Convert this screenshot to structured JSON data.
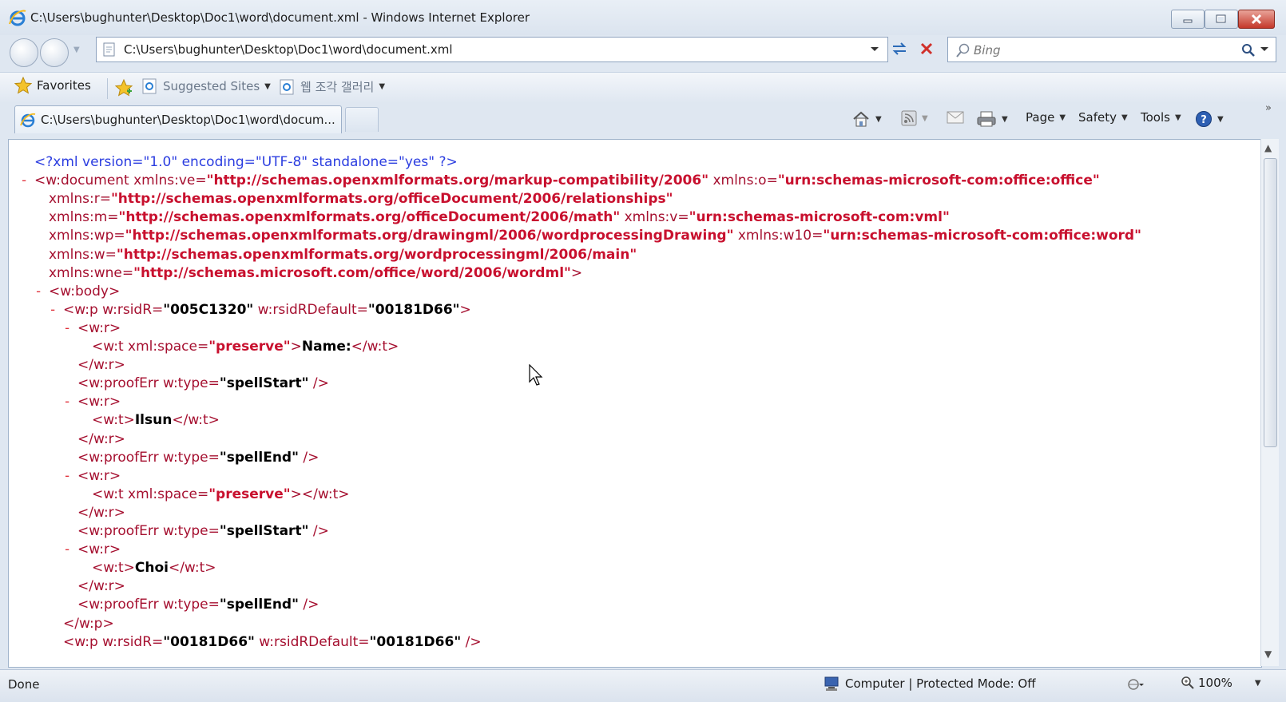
{
  "window": {
    "title": "C:\\Users\\bughunter\\Desktop\\Doc1\\word\\document.xml - Windows Internet Explorer"
  },
  "address_bar": {
    "url": "C:\\Users\\bughunter\\Desktop\\Doc1\\word\\document.xml"
  },
  "search": {
    "placeholder": "Bing"
  },
  "favorites_bar": {
    "favorites_label": "Favorites",
    "suggested_sites_label": "Suggested Sites",
    "web_slice_label": "웹 조각 갤러리"
  },
  "tab": {
    "label": "C:\\Users\\bughunter\\Desktop\\Doc1\\word\\docum..."
  },
  "command_bar": {
    "page_label": "Page",
    "safety_label": "Safety",
    "tools_label": "Tools"
  },
  "xml_lines": [
    {
      "minus": "",
      "parts": [
        [
          "b",
          "<?xml version=\"1.0\" encoding=\"UTF-8\" standalone=\"yes\" ?>"
        ]
      ]
    },
    {
      "minus": "-",
      "parts": [
        [
          "r",
          "<w:document "
        ],
        [
          "r",
          "xmlns:ve="
        ],
        [
          "rv",
          "\"http://schemas.openxmlformats.org/markup-compatibility/2006\""
        ],
        [
          "r",
          " xmlns:o="
        ],
        [
          "rv",
          "\"urn:schemas-microsoft-com:office:office\""
        ]
      ]
    },
    {
      "minus": "",
      "parts": [
        [
          "r",
          "xmlns:r="
        ],
        [
          "rv",
          "\"http://schemas.openxmlformats.org/officeDocument/2006/relationships\""
        ]
      ]
    },
    {
      "minus": "",
      "parts": [
        [
          "r",
          "xmlns:m="
        ],
        [
          "rv",
          "\"http://schemas.openxmlformats.org/officeDocument/2006/math\""
        ],
        [
          "r",
          " xmlns:v="
        ],
        [
          "rv",
          "\"urn:schemas-microsoft-com:vml\""
        ]
      ]
    },
    {
      "minus": "",
      "parts": [
        [
          "r",
          "xmlns:wp="
        ],
        [
          "rv",
          "\"http://schemas.openxmlformats.org/drawingml/2006/wordprocessingDrawing\""
        ],
        [
          "r",
          " xmlns:w10="
        ],
        [
          "rv",
          "\"urn:schemas-microsoft-com:office:word\""
        ]
      ]
    },
    {
      "minus": "",
      "parts": [
        [
          "r",
          "xmlns:w="
        ],
        [
          "rv",
          "\"http://schemas.openxmlformats.org/wordprocessingml/2006/main\""
        ]
      ]
    },
    {
      "minus": "",
      "parts": [
        [
          "r",
          "xmlns:wne="
        ],
        [
          "rv",
          "\"http://schemas.microsoft.com/office/word/2006/wordml\""
        ],
        [
          "r",
          ">"
        ]
      ]
    },
    {
      "minus": "-",
      "parts": [
        [
          "r",
          "<w:body>"
        ]
      ]
    },
    {
      "minus": "-",
      "parts": [
        [
          "r",
          "<w:p w:rsidR="
        ],
        [
          "t",
          "\"005C1320\""
        ],
        [
          "r",
          " w:rsidRDefault="
        ],
        [
          "t",
          "\"00181D66\""
        ],
        [
          "r",
          ">"
        ]
      ]
    },
    {
      "minus": "-",
      "parts": [
        [
          "r",
          "<w:r>"
        ]
      ]
    },
    {
      "minus": "",
      "parts": [
        [
          "r",
          "<w:t xml:space="
        ],
        [
          "rv",
          "\"preserve\""
        ],
        [
          "r",
          ">"
        ],
        [
          "t",
          "Name:"
        ],
        [
          "r",
          "</w:t>"
        ]
      ]
    },
    {
      "minus": "",
      "parts": [
        [
          "r",
          "</w:r>"
        ]
      ]
    },
    {
      "minus": "",
      "parts": [
        [
          "r",
          "<w:proofErr w:type="
        ],
        [
          "t",
          "\"spellStart\""
        ],
        [
          "r",
          " />"
        ]
      ]
    },
    {
      "minus": "-",
      "parts": [
        [
          "r",
          "<w:r>"
        ]
      ]
    },
    {
      "minus": "",
      "parts": [
        [
          "r",
          "<w:t>"
        ],
        [
          "t",
          "Ilsun"
        ],
        [
          "r",
          "</w:t>"
        ]
      ]
    },
    {
      "minus": "",
      "parts": [
        [
          "r",
          "</w:r>"
        ]
      ]
    },
    {
      "minus": "",
      "parts": [
        [
          "r",
          "<w:proofErr w:type="
        ],
        [
          "t",
          "\"spellEnd\""
        ],
        [
          "r",
          " />"
        ]
      ]
    },
    {
      "minus": "-",
      "parts": [
        [
          "r",
          "<w:r>"
        ]
      ]
    },
    {
      "minus": "",
      "parts": [
        [
          "r",
          "<w:t xml:space="
        ],
        [
          "rv",
          "\"preserve\""
        ],
        [
          "r",
          "></w:t>"
        ]
      ]
    },
    {
      "minus": "",
      "parts": [
        [
          "r",
          "</w:r>"
        ]
      ]
    },
    {
      "minus": "",
      "parts": [
        [
          "r",
          "<w:proofErr w:type="
        ],
        [
          "t",
          "\"spellStart\""
        ],
        [
          "r",
          " />"
        ]
      ]
    },
    {
      "minus": "-",
      "parts": [
        [
          "r",
          "<w:r>"
        ]
      ]
    },
    {
      "minus": "",
      "parts": [
        [
          "r",
          "<w:t>"
        ],
        [
          "t",
          "Choi"
        ],
        [
          "r",
          "</w:t>"
        ]
      ]
    },
    {
      "minus": "",
      "parts": [
        [
          "r",
          "</w:r>"
        ]
      ]
    },
    {
      "minus": "",
      "parts": [
        [
          "r",
          "<w:proofErr w:type="
        ],
        [
          "t",
          "\"spellEnd\""
        ],
        [
          "r",
          " />"
        ]
      ]
    },
    {
      "minus": "",
      "parts": [
        [
          "r",
          "</w:p>"
        ]
      ]
    },
    {
      "minus": "",
      "parts": [
        [
          "r",
          "<w:p w:rsidR="
        ],
        [
          "t",
          "\"00181D66\""
        ],
        [
          "r",
          " w:rsidRDefault="
        ],
        [
          "t",
          "\"00181D66\""
        ],
        [
          "r",
          " />"
        ]
      ]
    }
  ],
  "status_bar": {
    "status_text": "Done",
    "zone_text": "Computer | Protected Mode: Off",
    "zoom_text": "100%"
  },
  "icons": {
    "ie": "ie-icon",
    "refresh": "refresh-icon",
    "stop": "stop-icon",
    "search": "search-icon",
    "favorites": "star-icon",
    "home": "home-icon",
    "feeds": "rss-icon",
    "mail": "mail-icon",
    "print": "print-icon",
    "help": "help-icon"
  },
  "colors": {
    "tag": "#a50f2f",
    "attr_value": "#c8102e",
    "pi": "#2b3de0",
    "text_value": "#000000"
  }
}
